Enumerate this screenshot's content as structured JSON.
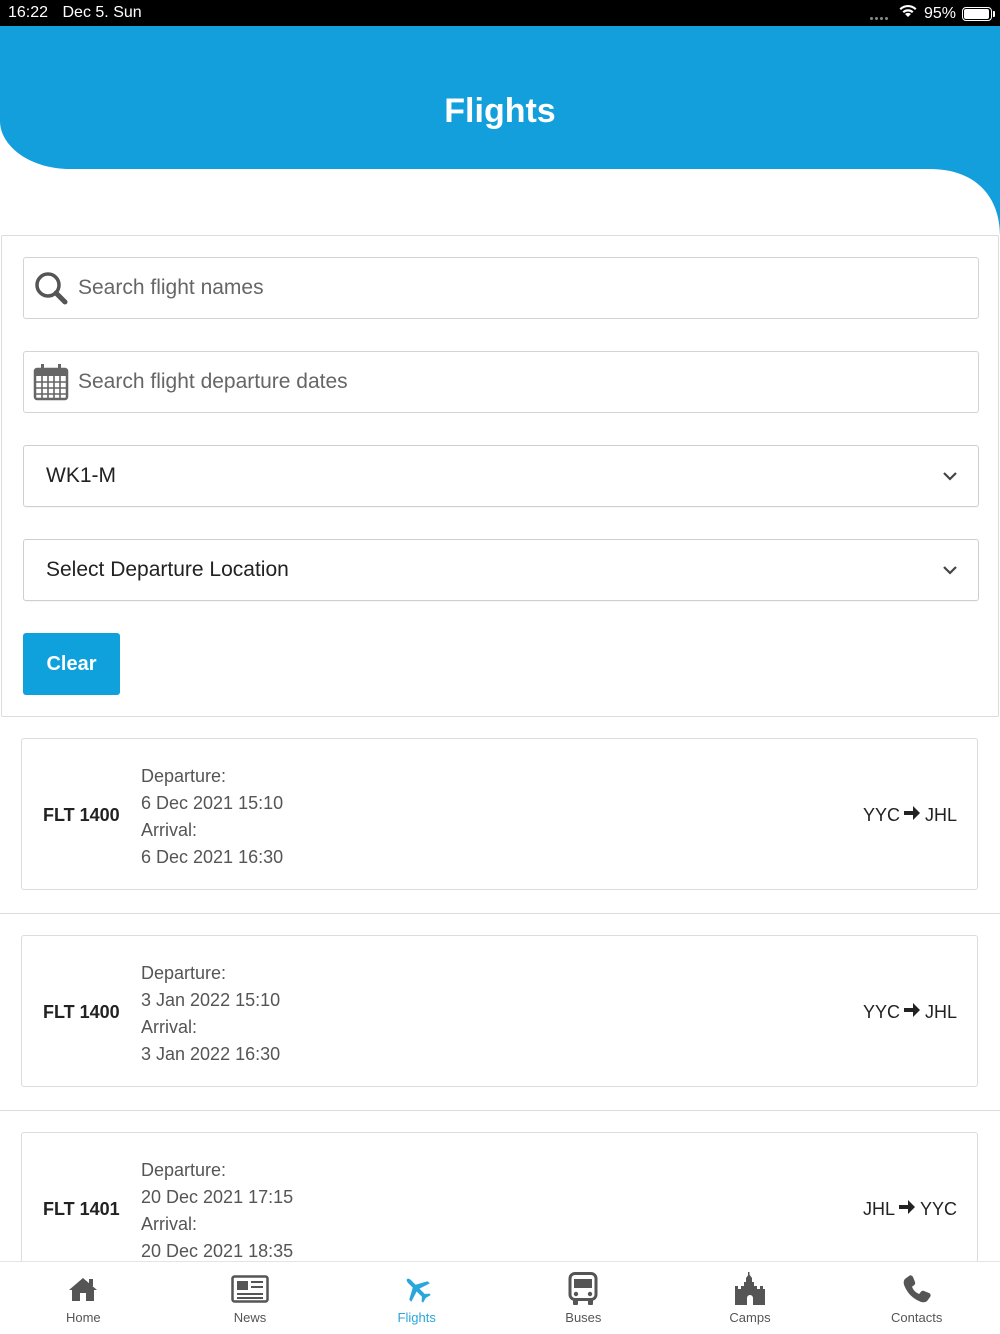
{
  "status_bar": {
    "time": "16:22",
    "date": "Dec 5. Sun",
    "battery": "95%",
    "battery_level": 0.95
  },
  "header": {
    "title": "Flights",
    "color": "#129fdc"
  },
  "filters": {
    "search_name_placeholder": "Search flight names",
    "search_date_placeholder": "Search flight departure dates",
    "group_select_value": "WK1-M",
    "location_select_value": "Select Departure Location",
    "clear_label": "Clear",
    "accent_color": "#0fa1dc"
  },
  "flights": [
    {
      "name": "FLT 1400",
      "departure_label": "Departure:",
      "departure": "6 Dec 2021 15:10",
      "arrival_label": "Arrival:",
      "arrival": "6 Dec 2021 16:30",
      "from": "YYC",
      "to": "JHL"
    },
    {
      "name": "FLT 1400",
      "departure_label": "Departure:",
      "departure": "3 Jan 2022 15:10",
      "arrival_label": "Arrival:",
      "arrival": "3 Jan 2022 16:30",
      "from": "YYC",
      "to": "JHL"
    },
    {
      "name": "FLT 1401",
      "departure_label": "Departure:",
      "departure": "20 Dec 2021 17:15",
      "arrival_label": "Arrival:",
      "arrival": "20 Dec 2021 18:35",
      "from": "JHL",
      "to": "YYC"
    }
  ],
  "tabs": [
    {
      "label": "Home",
      "icon": "home-icon",
      "active": false
    },
    {
      "label": "News",
      "icon": "news-icon",
      "active": false
    },
    {
      "label": "Flights",
      "icon": "plane-icon",
      "active": true
    },
    {
      "label": "Buses",
      "icon": "bus-icon",
      "active": false
    },
    {
      "label": "Camps",
      "icon": "castle-icon",
      "active": false
    },
    {
      "label": "Contacts",
      "icon": "phone-icon",
      "active": false
    }
  ]
}
